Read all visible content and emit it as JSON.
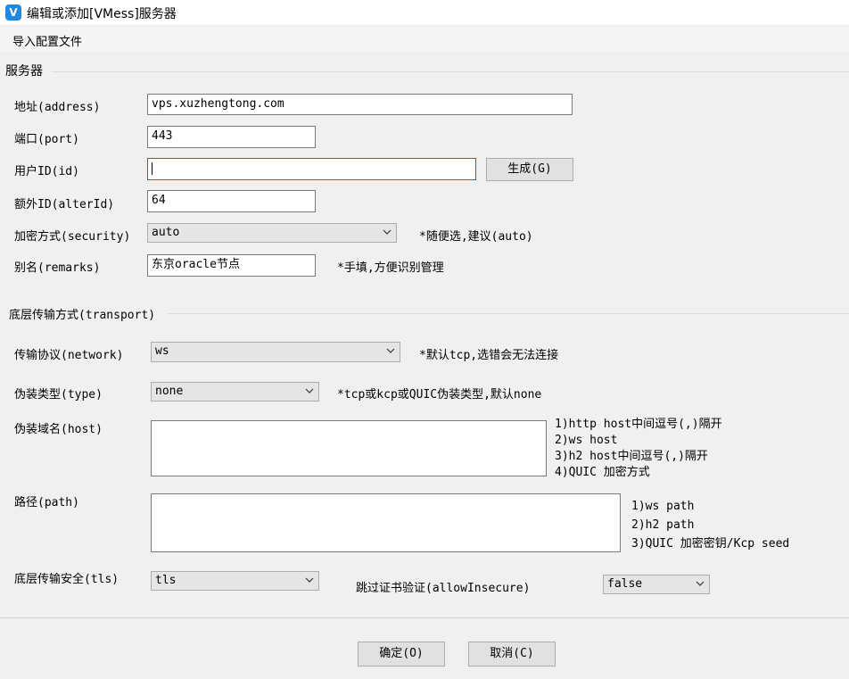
{
  "window": {
    "title": "编辑或添加[VMess]服务器",
    "icon": "v2rayn-app-icon"
  },
  "menu": {
    "import_config": "导入配置文件"
  },
  "server_group": {
    "title": "服务器",
    "address_label": "地址(address)",
    "address_value": "vps.xuzhengtong.com",
    "port_label": "端口(port)",
    "port_value": "443",
    "user_id_label": "用户ID(id)",
    "user_id_value": "",
    "generate_button": "生成(G)",
    "alter_id_label": "额外ID(alterId)",
    "alter_id_value": "64",
    "security_label": "加密方式(security)",
    "security_value": "auto",
    "security_hint": "*随便选,建议(auto)",
    "remarks_label": "别名(remarks)",
    "remarks_value": "东京oracle节点",
    "remarks_hint": "*手填,方便识别管理"
  },
  "transport_group": {
    "title": "底层传输方式(transport)",
    "network_label": "传输协议(network)",
    "network_value": "ws",
    "network_hint": "*默认tcp,选错会无法连接",
    "type_label": "伪装类型(type)",
    "type_value": "none",
    "type_hint": "*tcp或kcp或QUIC伪装类型,默认none",
    "host_label": "伪装域名(host)",
    "host_value": "",
    "host_hints": [
      "1)http host中间逗号(,)隔开",
      "2)ws host",
      "3)h2 host中间逗号(,)隔开",
      "4)QUIC 加密方式"
    ],
    "path_label": "路径(path)",
    "path_value": "",
    "path_hints": [
      "1)ws path",
      "2)h2 path",
      "3)QUIC 加密密钥/Kcp seed"
    ],
    "tls_label": "底层传输安全(tls)",
    "tls_value": "tls",
    "allow_insecure_label": "跳过证书验证(allowInsecure)",
    "allow_insecure_value": "false"
  },
  "footer": {
    "ok_button": "确定(O)",
    "cancel_button": "取消(C)"
  }
}
